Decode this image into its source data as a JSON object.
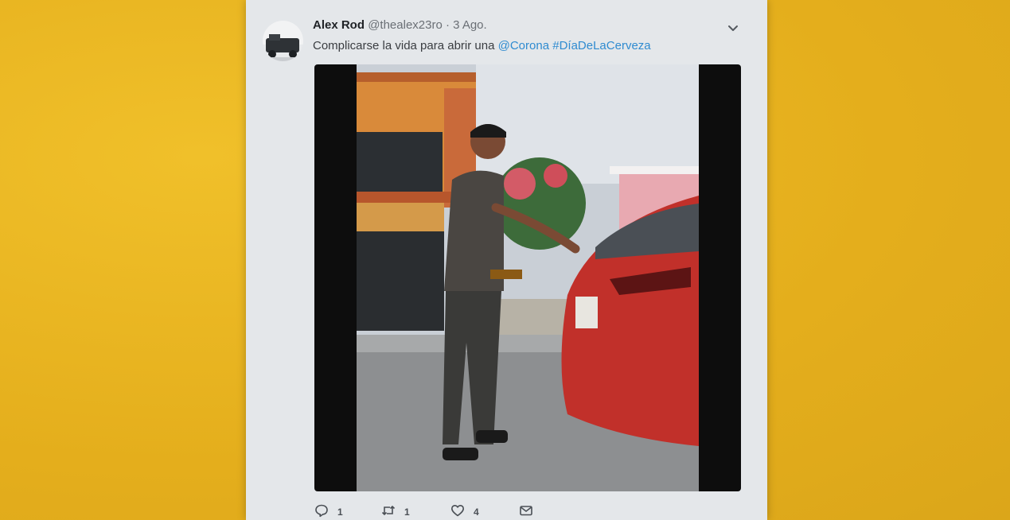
{
  "tweet": {
    "display_name": "Alex Rod",
    "handle": "@thealex23ro",
    "separator": "·",
    "date": "3 Ago.",
    "text_prefix": "Complicarse la vida para abrir una",
    "mention": "@Corona",
    "hashtag": "#DíaDeLaCerveza"
  },
  "actions": {
    "reply_count": "1",
    "retweet_count": "1",
    "like_count": "4"
  },
  "icons": {
    "avatar": "avatar-photo",
    "more": "chevron-down-icon",
    "reply": "reply-icon",
    "retweet": "retweet-icon",
    "like": "heart-icon",
    "message": "envelope-icon"
  },
  "colors": {
    "background": "#e9b41f",
    "card": "#e4e7ea",
    "link": "#2f8bd0",
    "text": "#3a3d41"
  }
}
